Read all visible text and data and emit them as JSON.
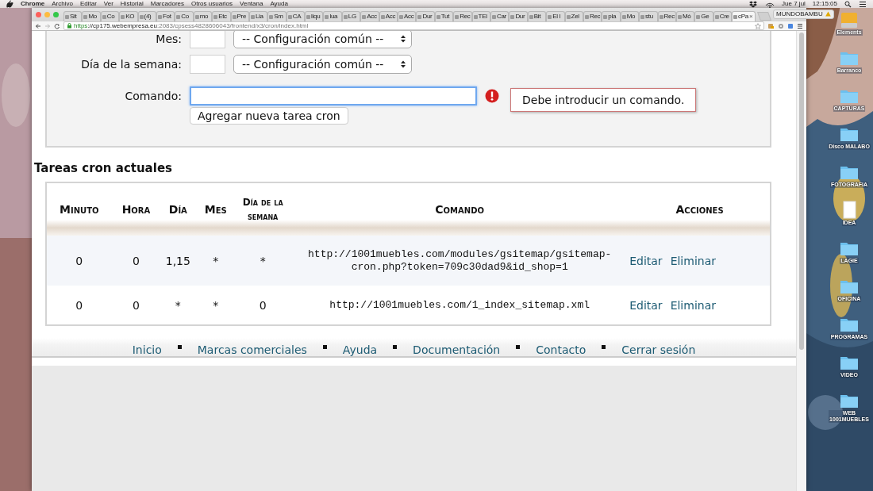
{
  "menu_bar": {
    "app": "Chrome",
    "items": [
      "Archivo",
      "Editar",
      "Ver",
      "Historial",
      "Marcadores",
      "Otros usuarios",
      "Ventana",
      "Ayuda"
    ],
    "date": "Jue 7 jul",
    "time": "12:15:05"
  },
  "browser": {
    "tabs": [
      {
        "label": "Sit",
        "selected": false
      },
      {
        "label": "Mo",
        "selected": false
      },
      {
        "label": "Co",
        "selected": false
      },
      {
        "label": "KO",
        "selected": false
      },
      {
        "label": "(4)",
        "selected": false
      },
      {
        "label": "Fot",
        "selected": false
      },
      {
        "label": "Co",
        "selected": false
      },
      {
        "label": "mo",
        "selected": false
      },
      {
        "label": "Etc",
        "selected": false
      },
      {
        "label": "Pre",
        "selected": false
      },
      {
        "label": "Lia",
        "selected": false
      },
      {
        "label": "Sm",
        "selected": false
      },
      {
        "label": "CA",
        "selected": false
      },
      {
        "label": "liqu",
        "selected": false
      },
      {
        "label": "lua",
        "selected": false
      },
      {
        "label": "LG",
        "selected": false
      },
      {
        "label": "Acc",
        "selected": false
      },
      {
        "label": "Acc",
        "selected": false
      },
      {
        "label": "Acc",
        "selected": false
      },
      {
        "label": "Dur",
        "selected": false
      },
      {
        "label": "Tut",
        "selected": false
      },
      {
        "label": "Rec",
        "selected": false
      },
      {
        "label": "TEl",
        "selected": false
      },
      {
        "label": "Car",
        "selected": false
      },
      {
        "label": "Dur",
        "selected": false
      },
      {
        "label": "Bit",
        "selected": false
      },
      {
        "label": "El l",
        "selected": false
      },
      {
        "label": "Zel",
        "selected": false
      },
      {
        "label": "Rec",
        "selected": false
      },
      {
        "label": "pla",
        "selected": false
      },
      {
        "label": "Mo",
        "selected": false
      },
      {
        "label": "stu",
        "selected": false
      },
      {
        "label": "Rec",
        "selected": false
      },
      {
        "label": "Mó",
        "selected": false
      },
      {
        "label": "Ge",
        "selected": false
      },
      {
        "label": "Cre",
        "selected": false
      },
      {
        "label": "cPa",
        "selected": true,
        "close": "×"
      }
    ],
    "profile": "MUNDOBAMBU",
    "address": {
      "scheme": "https",
      "host": "://cp175.webempresa.eu",
      "path": ":2083/cpsess4828606043/frontend/x3/cron/index.html"
    }
  },
  "form": {
    "rows": [
      {
        "label": "Mes:",
        "select": "-- Configuración común --"
      },
      {
        "label": "Día de la semana:",
        "select": "-- Configuración común --"
      }
    ],
    "command": {
      "label": "Comando:",
      "focused": true
    },
    "error": "Debe introducir un comando.",
    "submit": "Agregar nueva tarea cron"
  },
  "cron_table": {
    "title": "Tareas cron actuales",
    "columns": [
      "Minuto",
      "Hora",
      "Día",
      "Mes",
      "Día de la semana",
      "Comando",
      "Acciones"
    ],
    "rows": [
      {
        "cells": [
          "0",
          "0",
          "1,15",
          "*",
          "*",
          "http://1001muebles.com/modules/gsitemap/gsitemap-cron.php?token=709c30dad9&id_shop=1"
        ],
        "actions": [
          "Editar",
          "Eliminar"
        ]
      },
      {
        "cells": [
          "0",
          "0",
          "*",
          "*",
          "0",
          "http://1001muebles.com/1_index_sitemap.xml"
        ],
        "actions": [
          "Editar",
          "Eliminar"
        ]
      }
    ]
  },
  "footer_links": [
    "Inicio",
    "Marcas comerciales",
    "Ayuda",
    "Documentación",
    "Contacto",
    "Cerrar sesión"
  ],
  "desktop_icons": [
    {
      "label": "Elements",
      "kind": "drive"
    },
    {
      "label": "Barranco",
      "kind": "folder"
    },
    {
      "label": "CAPTURAS",
      "kind": "folder"
    },
    {
      "label": "Disco MALABO",
      "kind": "folder"
    },
    {
      "label": "FOTOGRAFIA",
      "kind": "folder"
    },
    {
      "label": "IDEA",
      "kind": "document"
    },
    {
      "label": "LAGIE",
      "kind": "folder"
    },
    {
      "label": "OFICINA",
      "kind": "folder"
    },
    {
      "label": "PROGRAMAS",
      "kind": "folder"
    },
    {
      "label": "VIDEO",
      "kind": "folder"
    },
    {
      "label": "WEB 1001MUEBLES",
      "kind": "folder"
    }
  ]
}
